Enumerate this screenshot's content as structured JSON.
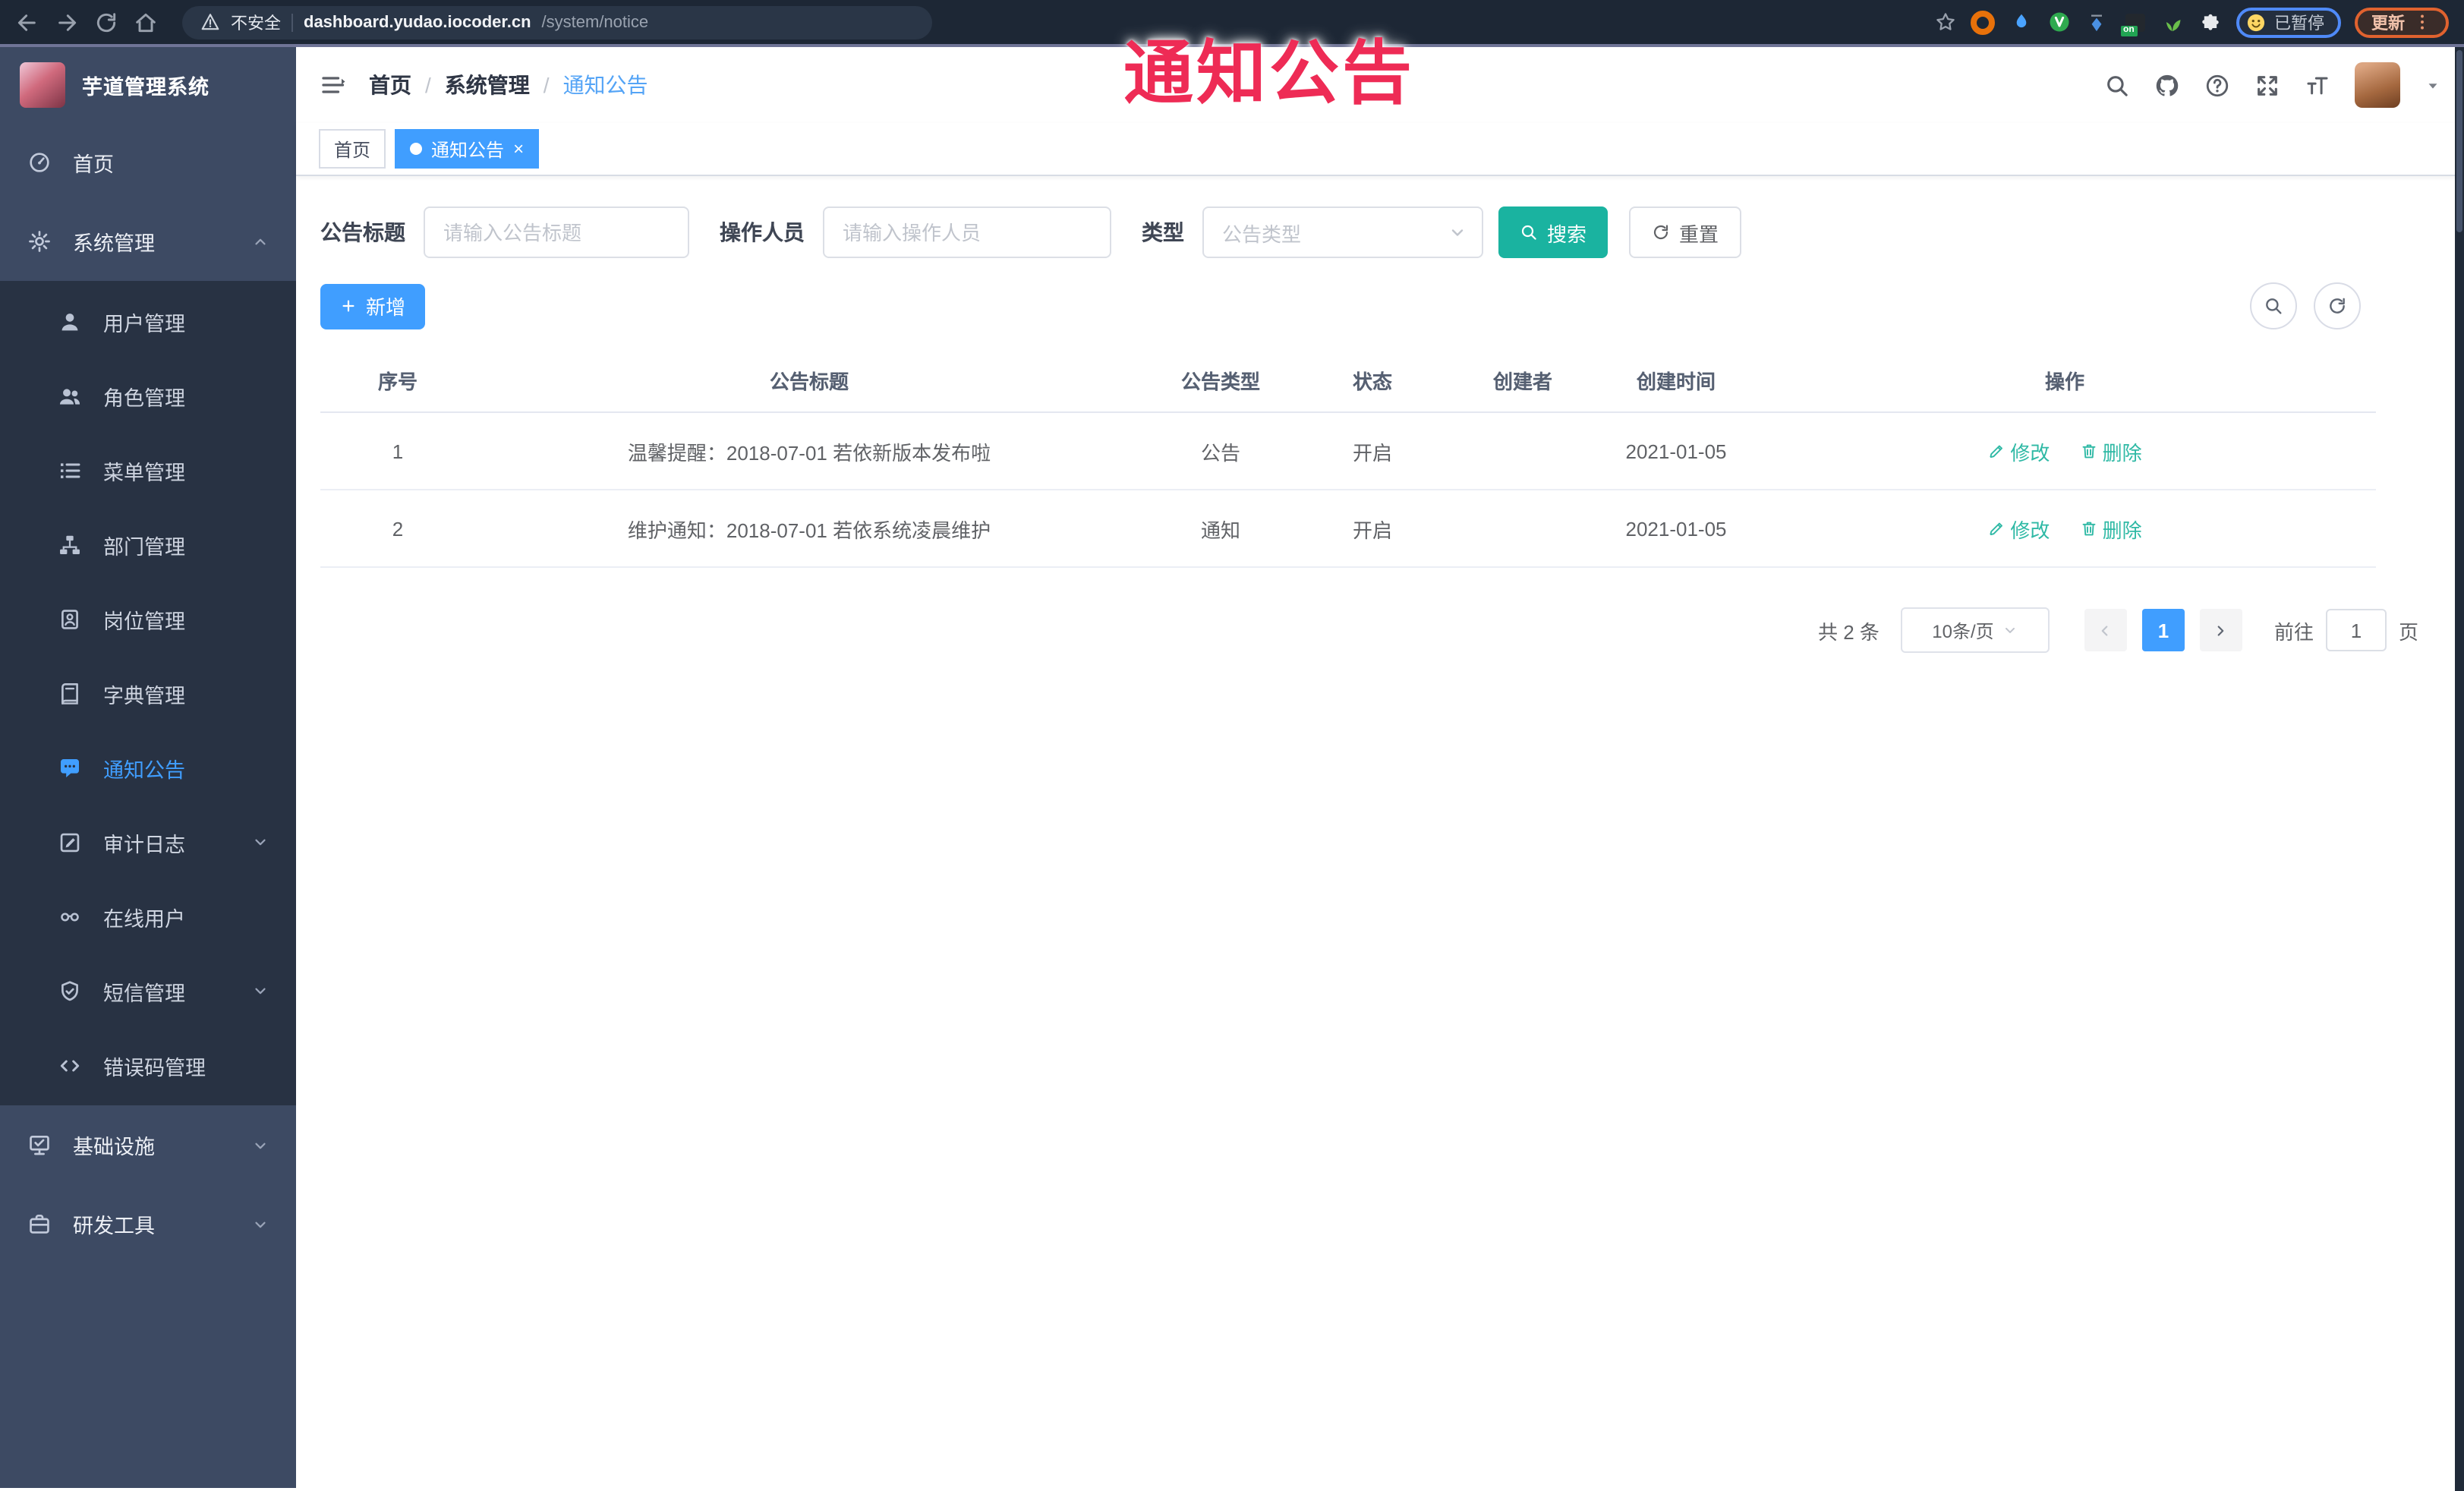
{
  "colors": {
    "accent": "#409eff",
    "search_button": "#1ab3a0",
    "action_link": "#2fb9a5",
    "overlay": "#ee2b55",
    "sidebar_bg": "#3d4a63",
    "submenu_bg": "#283243"
  },
  "browser": {
    "security": "不安全",
    "host": "dashboard.yudao.iocoder.cn",
    "path": "/system/notice",
    "paused_label": "已暂停",
    "update_label": "更新",
    "ext_badge": "on"
  },
  "overlay_title": "通知公告",
  "sidebar": {
    "title": "芋道管理系统",
    "items": [
      {
        "label": "首页"
      },
      {
        "label": "系统管理"
      },
      {
        "label": "用户管理"
      },
      {
        "label": "角色管理"
      },
      {
        "label": "菜单管理"
      },
      {
        "label": "部门管理"
      },
      {
        "label": "岗位管理"
      },
      {
        "label": "字典管理"
      },
      {
        "label": "通知公告"
      },
      {
        "label": "审计日志"
      },
      {
        "label": "在线用户"
      },
      {
        "label": "短信管理"
      },
      {
        "label": "错误码管理"
      },
      {
        "label": "基础设施"
      },
      {
        "label": "研发工具"
      }
    ]
  },
  "breadcrumb": {
    "separator": "/",
    "items": [
      "首页",
      "系统管理",
      "通知公告"
    ]
  },
  "tabs": [
    {
      "label": "首页"
    },
    {
      "label": "通知公告",
      "close": "×"
    }
  ],
  "filters": {
    "title_label": "公告标题",
    "title_placeholder": "请输入公告标题",
    "operator_label": "操作人员",
    "operator_placeholder": "请输入操作人员",
    "type_label": "类型",
    "type_placeholder": "公告类型",
    "search_label": "搜索",
    "reset_label": "重置"
  },
  "toolbar": {
    "add_label": "新增"
  },
  "table": {
    "columns": [
      "序号",
      "公告标题",
      "公告类型",
      "状态",
      "创建者",
      "创建时间",
      "操作"
    ],
    "rows": [
      {
        "no": "1",
        "title": "温馨提醒：2018-07-01 若依新版本发布啦",
        "type": "公告",
        "status": "开启",
        "creator": "",
        "time": "2021-01-05",
        "edit": "修改",
        "del": "删除"
      },
      {
        "no": "2",
        "title": "维护通知：2018-07-01 若依系统凌晨维护",
        "type": "通知",
        "status": "开启",
        "creator": "",
        "time": "2021-01-05",
        "edit": "修改",
        "del": "删除"
      }
    ]
  },
  "pagination": {
    "total": "共 2 条",
    "page_size": "10条/页",
    "current_page": "1",
    "goto_label": "前往",
    "goto_value": "1",
    "page_unit": "页"
  }
}
